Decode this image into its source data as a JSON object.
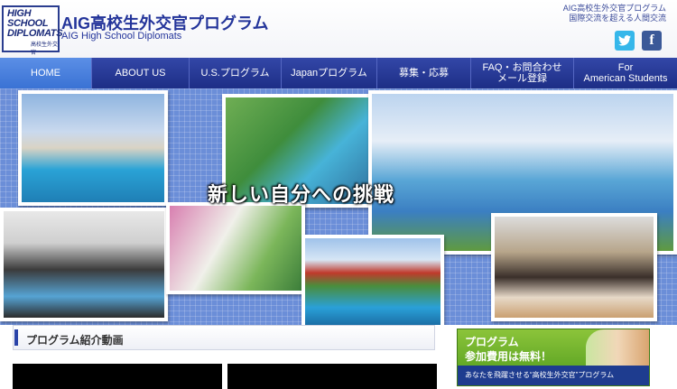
{
  "header": {
    "logo_text": "HIGH SCHOOL DIPLOMATS",
    "logo_sub": "高校生外交官",
    "title": "AIG高校生外交官プログラム",
    "subtitle": "AIG High School Diplomats",
    "tagline_line1": "AIG高校生外交官プログラム",
    "tagline_line2": "国際交流を超える人間交流",
    "social": [
      "twitter-icon",
      "facebook-icon"
    ]
  },
  "nav": [
    {
      "label": "HOME",
      "active": true
    },
    {
      "label": "ABOUT US"
    },
    {
      "label": "U.S.プログラム"
    },
    {
      "label": "Japanプログラム"
    },
    {
      "label": "募集・応募"
    },
    {
      "label": "FAQ・お問合わせ\nメール登録"
    },
    {
      "label": "For\nAmerican Students"
    }
  ],
  "hero": {
    "caption": "新しい自分への挑戦"
  },
  "section": {
    "title": "プログラム紹介動画"
  },
  "banner": {
    "line1": "プログラム",
    "line2": "参加費用は無料！",
    "line3": "あなたを飛躍させる“高校生外交官”プログラム"
  },
  "colors": {
    "nav": "#2438a0",
    "nav_active": "#4a80dc",
    "hero_bg": "#6b8ed8",
    "banner": "#6cb02c"
  }
}
